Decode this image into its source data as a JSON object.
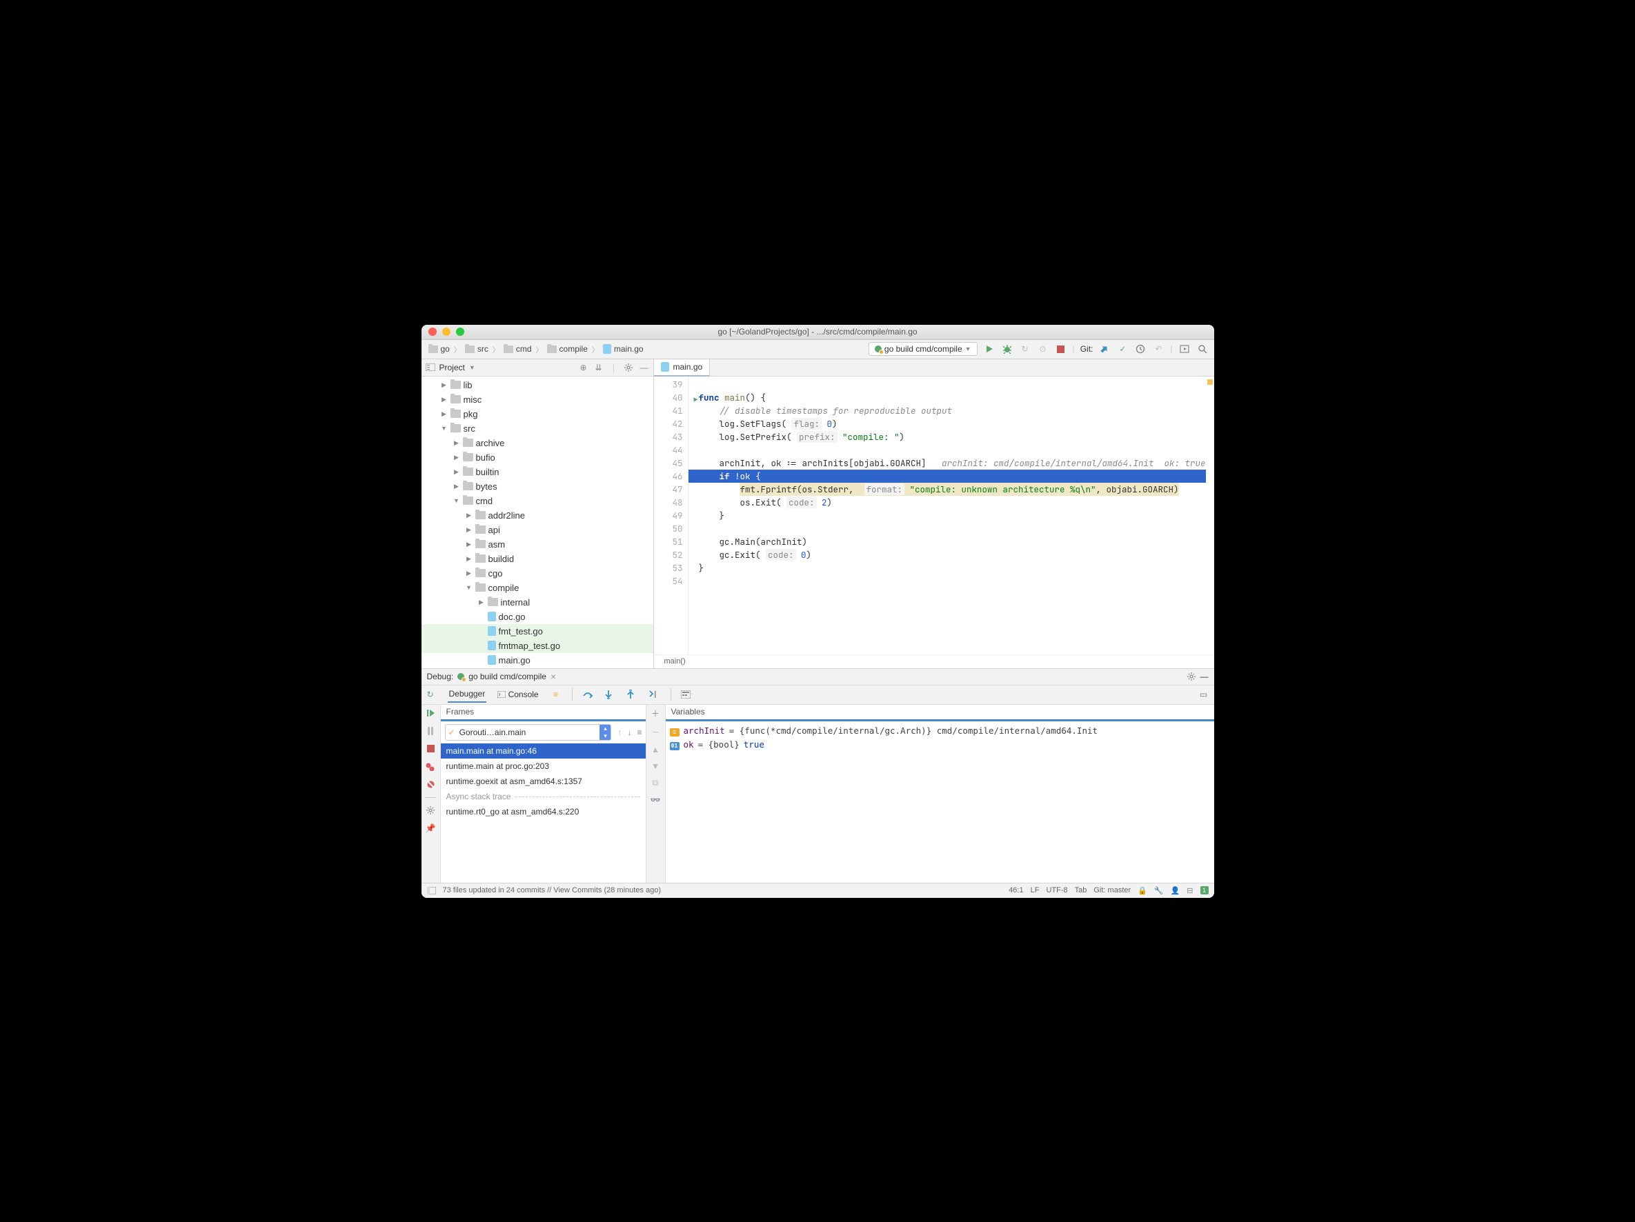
{
  "window": {
    "title": "go [~/GolandProjects/go] - .../src/cmd/compile/main.go"
  },
  "breadcrumb": [
    {
      "label": "go",
      "kind": "folder"
    },
    {
      "label": "src",
      "kind": "folder"
    },
    {
      "label": "cmd",
      "kind": "folder"
    },
    {
      "label": "compile",
      "kind": "folder"
    },
    {
      "label": "main.go",
      "kind": "gofile"
    }
  ],
  "runConfig": {
    "label": "go build cmd/compile"
  },
  "toolbar": {
    "git_label": "Git:"
  },
  "projectPanel": {
    "title": "Project",
    "tree": [
      {
        "depth": 1,
        "expand": "closed",
        "icon": "folder",
        "label": "lib"
      },
      {
        "depth": 1,
        "expand": "closed",
        "icon": "folder",
        "label": "misc"
      },
      {
        "depth": 1,
        "expand": "closed",
        "icon": "folder",
        "label": "pkg"
      },
      {
        "depth": 1,
        "expand": "open",
        "icon": "folder",
        "label": "src"
      },
      {
        "depth": 2,
        "expand": "closed",
        "icon": "folder",
        "label": "archive"
      },
      {
        "depth": 2,
        "expand": "closed",
        "icon": "folder",
        "label": "bufio"
      },
      {
        "depth": 2,
        "expand": "closed",
        "icon": "folder",
        "label": "builtin"
      },
      {
        "depth": 2,
        "expand": "closed",
        "icon": "folder",
        "label": "bytes"
      },
      {
        "depth": 2,
        "expand": "open",
        "icon": "folder",
        "label": "cmd"
      },
      {
        "depth": 3,
        "expand": "closed",
        "icon": "folder",
        "label": "addr2line"
      },
      {
        "depth": 3,
        "expand": "closed",
        "icon": "folder",
        "label": "api"
      },
      {
        "depth": 3,
        "expand": "closed",
        "icon": "folder",
        "label": "asm"
      },
      {
        "depth": 3,
        "expand": "closed",
        "icon": "folder",
        "label": "buildid"
      },
      {
        "depth": 3,
        "expand": "closed",
        "icon": "folder",
        "label": "cgo"
      },
      {
        "depth": 3,
        "expand": "open",
        "icon": "folder",
        "label": "compile"
      },
      {
        "depth": 4,
        "expand": "closed",
        "icon": "folder",
        "label": "internal"
      },
      {
        "depth": 4,
        "expand": "none",
        "icon": "gofile",
        "label": "doc.go"
      },
      {
        "depth": 4,
        "expand": "none",
        "icon": "gofile",
        "label": "fmt_test.go",
        "hl": true
      },
      {
        "depth": 4,
        "expand": "none",
        "icon": "gofile",
        "label": "fmtmap_test.go",
        "hl": true
      },
      {
        "depth": 4,
        "expand": "none",
        "icon": "gofile",
        "label": "main.go",
        "clip": true
      }
    ]
  },
  "editor": {
    "tab": "main.go",
    "breadcrumb": "main()",
    "lines": [
      {
        "n": 39,
        "html": ""
      },
      {
        "n": 40,
        "html": "<span class='kw'>func</span> <span class='fn'>main</span>() {",
        "run": true
      },
      {
        "n": 41,
        "html": "    <span class='cmt'>// disable timestamps for reproducible output</span>"
      },
      {
        "n": 42,
        "html": "    log.SetFlags( <span class='param'>flag:</span> <span class='num'>0</span>)"
      },
      {
        "n": 43,
        "html": "    log.SetPrefix( <span class='param'>prefix:</span> <span class='str'>\"compile: \"</span>)"
      },
      {
        "n": 44,
        "html": ""
      },
      {
        "n": 45,
        "html": "    archInit, ok := archInits[objabi.GOARCH]   <span class='hint'>archInit: cmd/compile/internal/amd64.Init  ok: true</span>"
      },
      {
        "n": 46,
        "html": "    <span class='kw' style='color:#fff'>if</span> !ok {",
        "bp": true,
        "highlighted": true
      },
      {
        "n": 47,
        "html": "        <span class='hl-frag'>fmt.Fprintf(os.Stderr,  <span class='param'>format:</span> <span class='str'>\"compile: unknown architecture %q\\n\"</span>, objabi.GOARCH)</span>"
      },
      {
        "n": 48,
        "html": "        os.Exit( <span class='param'>code:</span> <span class='num'>2</span>)"
      },
      {
        "n": 49,
        "html": "    }"
      },
      {
        "n": 50,
        "html": ""
      },
      {
        "n": 51,
        "html": "    gc.Main(archInit)"
      },
      {
        "n": 52,
        "html": "    gc.Exit( <span class='param'>code:</span> <span class='num'>0</span>)"
      },
      {
        "n": 53,
        "html": "}"
      },
      {
        "n": 54,
        "html": ""
      }
    ]
  },
  "debug": {
    "label": "Debug:",
    "config": "go build cmd/compile",
    "tabs": {
      "debugger": "Debugger",
      "console": "Console"
    },
    "frames": {
      "title": "Frames",
      "goroutine": "Gorouti…ain.main",
      "items": [
        {
          "label": "main.main at main.go:46",
          "sel": true
        },
        {
          "label": "runtime.main at proc.go:203"
        },
        {
          "label": "runtime.goexit at asm_amd64.s:1357"
        }
      ],
      "async_label": "Async stack trace",
      "async_items": [
        {
          "label": "runtime.rt0_go at asm_amd64.s:220"
        }
      ]
    },
    "variables": {
      "title": "Variables",
      "items": [
        {
          "kind": "f",
          "name": "archInit",
          "val": " = {func(*cmd/compile/internal/gc.Arch)} cmd/compile/internal/amd64.Init"
        },
        {
          "kind": "b",
          "name": "ok",
          "val": " = {bool} ",
          "bool": "true"
        }
      ]
    }
  },
  "statusbar": {
    "msg": "73 files updated in 24 commits // View Commits (28 minutes ago)",
    "pos": "46:1",
    "le": "LF",
    "enc": "UTF-8",
    "ind": "Tab",
    "git": "Git: master"
  }
}
